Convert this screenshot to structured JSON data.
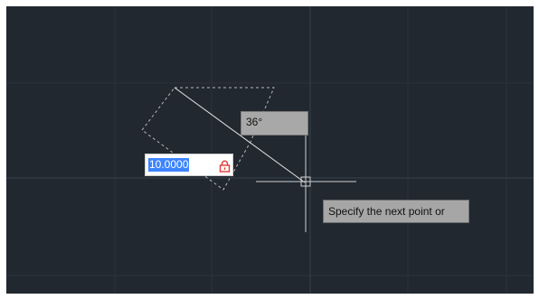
{
  "dynamic_input": {
    "distance_value": "10.0000",
    "angle_value": "36°",
    "lock_icon": "padlock-icon"
  },
  "command_prompt": {
    "text": "Specify the next point or"
  },
  "colors": {
    "canvas_background": "#212830",
    "grid_line": "#2a323c",
    "axis_line": "#37414c",
    "selection_highlight": "#3d85ff",
    "lock_icon_color": "#e53935",
    "tooltip_background": "#a8a8a8"
  }
}
